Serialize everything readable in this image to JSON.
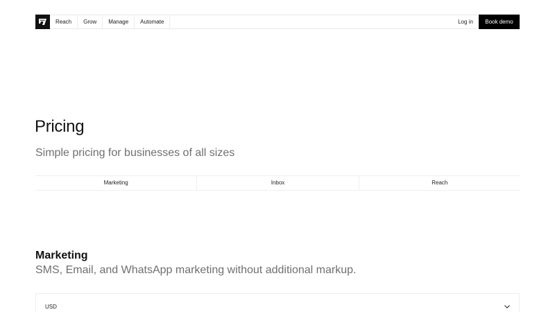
{
  "nav": {
    "logo_icon": "brand-logo-icon",
    "links": [
      {
        "label": "Reach"
      },
      {
        "label": "Grow"
      },
      {
        "label": "Manage"
      },
      {
        "label": "Automate"
      }
    ],
    "login_label": "Log in",
    "demo_label": "Book demo"
  },
  "hero": {
    "title": "Pricing",
    "subtitle": "Simple pricing for businesses of all sizes"
  },
  "tabs": [
    {
      "label": "Marketing"
    },
    {
      "label": "Inbox"
    },
    {
      "label": "Reach"
    }
  ],
  "section": {
    "title": "Marketing",
    "subtitle": "SMS, Email, and WhatsApp marketing without additional markup."
  },
  "currency": {
    "selected": "USD",
    "icon": "chevron-down-icon"
  },
  "colors": {
    "text": "#111111",
    "muted": "#6f6f6f",
    "button_bg": "#000000",
    "button_text": "#ffffff",
    "border": "#ececec"
  }
}
